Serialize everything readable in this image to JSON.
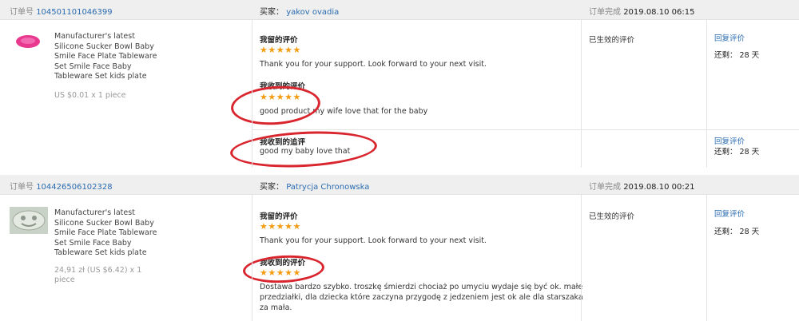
{
  "orders": [
    {
      "order_label": "订单号",
      "order_number": "104501101046399",
      "buyer_label": "买家：",
      "buyer_name": "yakov ovadia",
      "complete_label": "订单完成",
      "complete_time": "2019.08.10 06:15",
      "product_title_lines": [
        "Manufacturer's latest",
        "Silicone Sucker Bowl Baby",
        "Smile Face Plate Tableware",
        "Set Smile Face Baby",
        "Tableware Set kids plate"
      ],
      "price_lines": [
        "US $0.01 x 1 piece"
      ],
      "my_review_label": "我留的评价",
      "my_review_stars": "★★★★★",
      "my_review_text": "Thank you for your support. Look forward to your next visit.",
      "received_review_label": "我收到的评价",
      "received_review_stars": "★★★★★",
      "received_review_text": "good product my wife love that for the baby",
      "followup_label": "我收到的追评",
      "followup_text": "good my baby love that",
      "status": "已生效的评价",
      "reply_label": "回复评价",
      "remaining": "还剩： 28 天",
      "reply_label_2": "回复评价",
      "remaining_2": "还剩： 28 天"
    },
    {
      "order_label": "订单号",
      "order_number": "104426506102328",
      "buyer_label": "买家：",
      "buyer_name": "Patrycja Chronowska",
      "complete_label": "订单完成",
      "complete_time": "2019.08.10 00:21",
      "product_title_lines": [
        "Manufacturer's latest",
        "Silicone Sucker Bowl Baby",
        "Smile Face Plate Tableware",
        "Set Smile Face Baby",
        "Tableware Set kids plate"
      ],
      "price_lines": [
        "24,91 zł (US $6.42) x 1",
        "piece"
      ],
      "my_review_label": "我留的评价",
      "my_review_stars": "★★★★★",
      "my_review_text": "Thank you for your support. Look forward to your next visit.",
      "received_review_label": "我收到的评价",
      "received_review_stars": "★★★★★",
      "received_review_lines": [
        "Dostawa bardzo szybko. troszkę śmierdzi chociaż po umyciu wydaje się być ok. małe",
        "przedziałki, dla dziecka które zaczyna przygodę z jedzeniem jest ok ale dla starszaka",
        "za mała."
      ],
      "status": "已生效的评价",
      "reply_label": "回复评价",
      "remaining": "还剩： 28 天"
    }
  ],
  "colors": {
    "link": "#2a6bb0",
    "star": "#f39c12",
    "annotation": "#d9252e",
    "header_bg": "#efefef"
  }
}
